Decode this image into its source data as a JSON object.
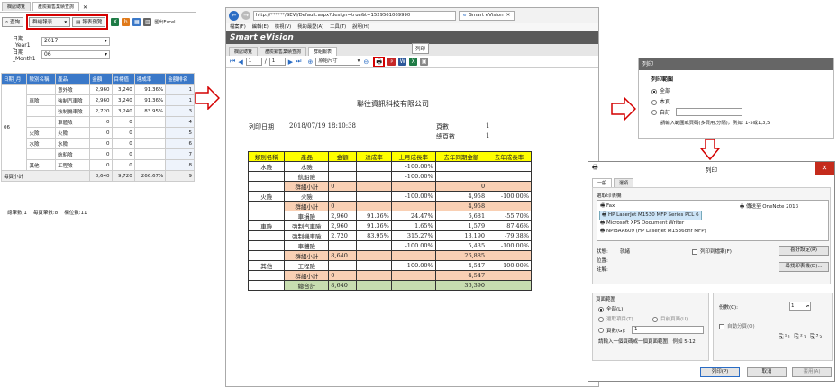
{
  "left": {
    "tabs": [
      "欄處總覽",
      "產險銷售業績查詢"
    ],
    "toolbar": {
      "query": "查詢",
      "select": "群組報表",
      "preview": "報表預覽",
      "export": "匯出Excel"
    },
    "filters": [
      {
        "label": "日期_Year1",
        "value": "2017"
      },
      {
        "label": "日期_Month1",
        "value": "06"
      }
    ],
    "columns": [
      "日期_月",
      "險別名稱",
      "產品",
      "金額",
      "目標值",
      "達成率",
      "金額排名"
    ],
    "month": "06",
    "rows": [
      {
        "cat": "",
        "prod": "意外險",
        "amt": "2,960",
        "target": "3,240",
        "rate": "91.36%",
        "rank": "1"
      },
      {
        "cat": "車險",
        "prod": "強制汽車險",
        "amt": "2,960",
        "target": "3,240",
        "rate": "91.36%",
        "rank": "1"
      },
      {
        "cat": "",
        "prod": "強制機車險",
        "amt": "2,720",
        "target": "3,240",
        "rate": "83.95%",
        "rank": "3"
      },
      {
        "cat": "",
        "prod": "車體險",
        "amt": "0",
        "target": "0",
        "rate": "",
        "rank": "4"
      },
      {
        "cat": "火險",
        "prod": "火險",
        "amt": "0",
        "target": "0",
        "rate": "",
        "rank": "5"
      },
      {
        "cat": "水險",
        "prod": "水險",
        "amt": "0",
        "target": "0",
        "rate": "",
        "rank": "6"
      },
      {
        "cat": "",
        "prod": "航船險",
        "amt": "0",
        "target": "0",
        "rate": "",
        "rank": "7"
      },
      {
        "cat": "其他",
        "prod": "工程險",
        "amt": "0",
        "target": "0",
        "rate": "",
        "rank": "8"
      }
    ],
    "total": {
      "label": "每頁小計",
      "amt": "8,640",
      "target": "9,720",
      "rate": "266.67%",
      "rank": "9"
    },
    "footer": "總筆數:1    每頁筆數:8    欄位數:11"
  },
  "browser": {
    "url": "http://******/SEVI/Default.aspx?design=true&t=1529561069990",
    "tab_title": "Smart eVision",
    "menu": [
      "檔案(F)",
      "編輯(E)",
      "檢視(V)",
      "我的最愛(A)",
      "工具(T)",
      "說明(H)"
    ],
    "app_title": "Smart eVision",
    "app_tabs": [
      "欄處總覽",
      "產險銷售業績查詢",
      "群組報表"
    ],
    "page_current": "1",
    "page_total": "1",
    "zoom": "原始尺寸",
    "tooltip": "列印"
  },
  "report": {
    "company": "聯往資訊科技有限公司",
    "print_date_label": "列印日期",
    "print_date": "2018/07/19 18:10:38",
    "page_label": "頁數",
    "page_value": "1",
    "total_pages_label": "總頁數",
    "total_pages_value": "1",
    "headers": [
      "類別名稱",
      "產品",
      "金額",
      "達成率",
      "上月成長率",
      "去年同期金額",
      "去年成長率"
    ],
    "rows": [
      {
        "type": "data",
        "cat": "水險",
        "prod": "水險",
        "amt": "",
        "rate": "",
        "mom": "-100.00%",
        "ly": "",
        "yoy": ""
      },
      {
        "type": "data",
        "cat": "",
        "prod": "航船險",
        "amt": "",
        "rate": "",
        "mom": "-100.00%",
        "ly": "",
        "yoy": ""
      },
      {
        "type": "sub",
        "cat": "",
        "prod": "群組小計",
        "amt": "0",
        "rate": "",
        "mom": "",
        "ly": "0",
        "yoy": ""
      },
      {
        "type": "data",
        "cat": "火險",
        "prod": "火險",
        "amt": "",
        "rate": "",
        "mom": "-100.00%",
        "ly": "4,958",
        "yoy": "-100.00%"
      },
      {
        "type": "sub",
        "cat": "",
        "prod": "群組小計",
        "amt": "0",
        "rate": "",
        "mom": "",
        "ly": "4,958",
        "yoy": ""
      },
      {
        "type": "data",
        "cat": "",
        "prod": "車損險",
        "amt": "2,960",
        "rate": "91.36%",
        "mom": "24.47%",
        "ly": "6,681",
        "yoy": "-55.70%"
      },
      {
        "type": "data",
        "cat": "車險",
        "prod": "強制汽車險",
        "amt": "2,960",
        "rate": "91.36%",
        "mom": "1.65%",
        "ly": "1,579",
        "yoy": "87.46%"
      },
      {
        "type": "data",
        "cat": "",
        "prod": "強制機車險",
        "amt": "2,720",
        "rate": "83.95%",
        "mom": "315.27%",
        "ly": "13,190",
        "yoy": "-79.38%"
      },
      {
        "type": "data",
        "cat": "",
        "prod": "車體險",
        "amt": "",
        "rate": "",
        "mom": "-100.00%",
        "ly": "5,435",
        "yoy": "-100.00%"
      },
      {
        "type": "sub",
        "cat": "",
        "prod": "群組小計",
        "amt": "8,640",
        "rate": "",
        "mom": "",
        "ly": "26,885",
        "yoy": ""
      },
      {
        "type": "data",
        "cat": "其他",
        "prod": "工程險",
        "amt": "",
        "rate": "",
        "mom": "-100.00%",
        "ly": "4,547",
        "yoy": "-100.00%"
      },
      {
        "type": "sub",
        "cat": "",
        "prod": "群組小計",
        "amt": "0",
        "rate": "",
        "mom": "",
        "ly": "4,547",
        "yoy": ""
      },
      {
        "type": "grand",
        "cat": "",
        "prod": "總合計",
        "amt": "8,640",
        "rate": "",
        "mom": "",
        "ly": "36,390",
        "yoy": ""
      }
    ]
  },
  "print_range": {
    "title": "列印",
    "section": "列印範圍",
    "options": [
      "全部",
      "本頁",
      "自訂"
    ],
    "hint": "請輸入範圍或頁碼(多頁用,分隔)，例如: 1-5或1,3,5"
  },
  "print_dialog": {
    "title": "列印",
    "tabs": [
      "一般",
      "選項"
    ],
    "select_printer": "選取印表機",
    "printers": [
      "Fax",
      "HP LaserJet M1530 MFP Series PCL 6",
      "Microsoft XPS Document Writer",
      "NPIBAA609 (HP LaserJet M1536dnf MFP)",
      "傳送至 OneNote 2013"
    ],
    "status_label": "狀態:",
    "status_value": "就緒",
    "location_label": "位置:",
    "comment_label": "註解:",
    "print_to_file": "列印到檔案(F)",
    "preferences": "喜好設定(R)",
    "find_printer": "尋找印表機(D)...",
    "page_range": "頁面範圍",
    "range_opts": [
      "全部(L)",
      "選取項目(T)",
      "目前頁面(U)",
      "頁數(G):"
    ],
    "pages_value": "1",
    "pages_hint": "請輸入一個頁碼或一個頁面範圍，例如 5-12",
    "copies_label": "份數(C):",
    "copies_value": "1",
    "collate": "自動分頁(O)",
    "btn_print": "列印(P)",
    "btn_cancel": "取消",
    "btn_apply": "套用(A)"
  },
  "colors": {
    "header_blue": "#3a78c8",
    "report_yellow": "#ffff00",
    "subtotal": "#f9d0b4",
    "grand": "#c7ddb0",
    "red": "#d40000",
    "app_bar": "#5a5a5a"
  }
}
